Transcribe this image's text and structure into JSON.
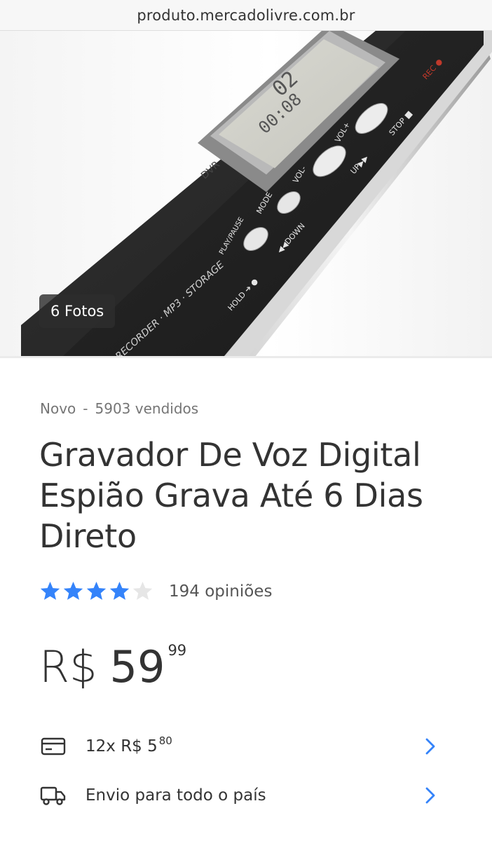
{
  "browser": {
    "url": "produto.mercadolivre.com.br"
  },
  "gallery": {
    "photo_count_label": "6 Fotos",
    "device_labels": {
      "model": "DVR",
      "mode": "MODE",
      "vol_minus": "VOL-",
      "vol_plus": "VOL+",
      "play_pause": "PLAY/PAUSE",
      "down": "◀◀DOWN",
      "up": "UP▶▶",
      "stop": "STOP ■",
      "hold": "HOLD ➔ ●",
      "rec": "REC ●",
      "side_text": "RECORDER · MP3 · STORAGE",
      "display_top": "02",
      "display_bottom": "00:08"
    }
  },
  "product": {
    "condition": "Novo",
    "separator": "-",
    "sold": "5903 vendidos",
    "title": "Gravador De Voz Digital Espião Grava Até 6 Dias Direto",
    "rating": {
      "stars_filled": 4,
      "stars_total": 5,
      "reviews": "194 opiniões"
    },
    "price": {
      "currency": "R$",
      "integer": "59",
      "cents": "99"
    },
    "installments": {
      "text": "12x R$ 5",
      "cents": "80"
    },
    "shipping": "Envio para todo o país"
  },
  "colors": {
    "star_filled": "#3483fa",
    "star_empty": "#e6e6e6",
    "chevron": "#3483fa"
  },
  "icons": [
    "card-icon",
    "truck-icon",
    "chevron-right-icon",
    "star-icon"
  ]
}
